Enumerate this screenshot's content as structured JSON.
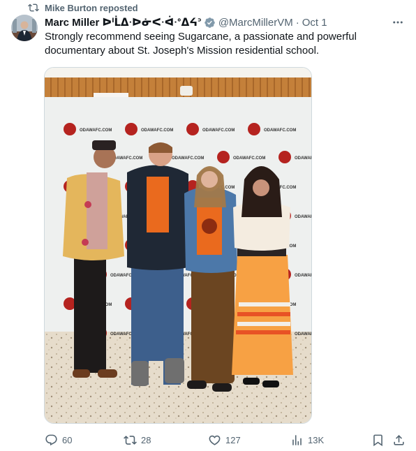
{
  "repost": {
    "text": "Mike Burton reposted"
  },
  "tweet": {
    "author_name": "Marc Miller ᐅᑊᒫᐃᐧᐅᓃᐸᐧᐋᐧᐤᐃᔦᐣ",
    "handle": "@MarcMillerVM",
    "separator": "·",
    "date": "Oct 1",
    "text": "Strongly recommend seeing Sugarcane, a passionate and powerful documentary about St. Joseph's Mission residential school."
  },
  "media": {
    "backdrop_logo_text": "ODAWAFC.COM",
    "colors": {
      "backdrop": "#eef0ef",
      "logo_red": "#b5231f",
      "floor": "#e6dccb",
      "wall": "#c9853e"
    }
  },
  "stats": {
    "replies": "60",
    "reposts": "28",
    "likes": "127",
    "views": "13K"
  },
  "icons": [
    "repost-icon",
    "verified-badge-icon",
    "more-icon",
    "reply-icon",
    "like-icon",
    "views-icon",
    "bookmark-icon",
    "share-icon"
  ],
  "colors": {
    "text": "#0f1419",
    "secondary": "#536471",
    "verified": "#829aab",
    "border": "#cfd9de"
  }
}
